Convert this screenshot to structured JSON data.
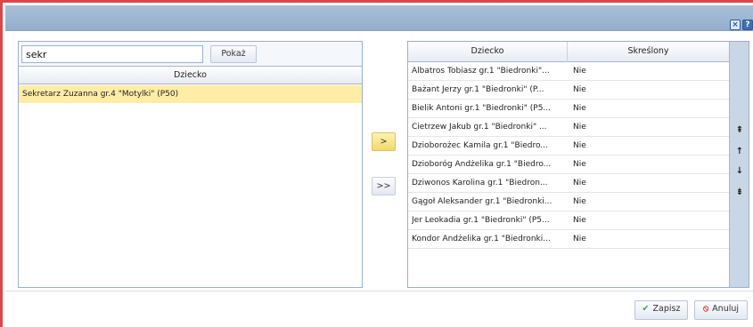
{
  "window": {
    "close_glyph": "×",
    "help_glyph": "?"
  },
  "left": {
    "search": {
      "value": "sekr"
    },
    "show_button": "Pokaż",
    "column_header": "Dziecko",
    "rows": [
      "Sekretarz Zuzanna gr.4 \"Motylki\" (P50)"
    ]
  },
  "move": {
    "one_label": ">",
    "all_label": ">>"
  },
  "right": {
    "columns": [
      "Dziecko",
      "Skreślony"
    ],
    "rows": [
      {
        "name": "Albatros Tobiasz gr.1 \"Biedronki\"...",
        "value": "Nie"
      },
      {
        "name": "Bażant Jerzy gr.1 \"Biedronki\" (P...",
        "value": "Nie"
      },
      {
        "name": "Bielik Antoni gr.1 \"Biedronki\" (P5...",
        "value": "Nie"
      },
      {
        "name": "Cietrzew Jakub gr.1 \"Biedronki\" ...",
        "value": "Nie"
      },
      {
        "name": "Dzioborożec Kamila gr.1 \"Biedro...",
        "value": "Nie"
      },
      {
        "name": "Dzioboróg Andżelika gr.1 \"Biedro...",
        "value": "Nie"
      },
      {
        "name": "Dziwonos Karolina gr.1 \"Biedron...",
        "value": "Nie"
      },
      {
        "name": "Gągoł Aleksander gr.1 \"Biedronki...",
        "value": "Nie"
      },
      {
        "name": "Jer Leokadia gr.1 \"Biedronki\" (P5...",
        "value": "Nie"
      },
      {
        "name": "Kondor Andżelika gr.1 \"Biedronki...",
        "value": "Nie"
      }
    ],
    "order_buttons": [
      "⇞",
      "↑",
      "↓",
      "⇟"
    ]
  },
  "footer": {
    "save_label": "Zapisz",
    "cancel_label": "Anuluj"
  },
  "colors": {
    "title_bar": "#a9bfd8",
    "selected_row": "#ffeda5",
    "frame_border": "#d9474b"
  }
}
